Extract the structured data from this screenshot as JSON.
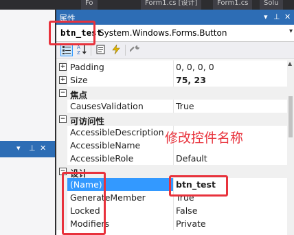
{
  "tabs": [
    "Fo",
    "Form1.cs [设计]",
    "Form1.cs",
    "Solu"
  ],
  "left_panel": {
    "pin": "⊥",
    "close": "✕",
    "dropdown": "▾"
  },
  "properties": {
    "title": "属性",
    "title_controls": {
      "dropdown": "▾",
      "pin": "⊥",
      "close": "✕"
    },
    "object_name": "btn_test",
    "object_type": "System.Windows.Forms.Button",
    "rows": [
      {
        "type": "prop",
        "expander": "+",
        "name": "Padding",
        "value": "0, 0, 0, 0"
      },
      {
        "type": "prop",
        "expander": "+",
        "name": "Size",
        "value": "75, 23",
        "bold": true
      },
      {
        "type": "category",
        "expander": "−",
        "name": "焦点"
      },
      {
        "type": "prop",
        "name": "CausesValidation",
        "value": "True"
      },
      {
        "type": "category",
        "expander": "−",
        "name": "可访问性"
      },
      {
        "type": "prop",
        "name": "AccessibleDescription",
        "value": ""
      },
      {
        "type": "prop",
        "name": "AccessibleName",
        "value": ""
      },
      {
        "type": "prop",
        "name": "AccessibleRole",
        "value": "Default"
      },
      {
        "type": "category",
        "expander": "−",
        "name": "设计"
      },
      {
        "type": "prop",
        "name": "(Name)",
        "value": "btn_test",
        "bold": true,
        "selected": true
      },
      {
        "type": "prop",
        "name": "GenerateMember",
        "value": "True"
      },
      {
        "type": "prop",
        "name": "Locked",
        "value": "False"
      },
      {
        "type": "prop",
        "name": "Modifiers",
        "value": "Private"
      }
    ]
  },
  "annotation": "修改控件名称",
  "colors": {
    "accent": "#2d6db5",
    "selection": "#3399ff",
    "annotation": "#e8323c"
  }
}
